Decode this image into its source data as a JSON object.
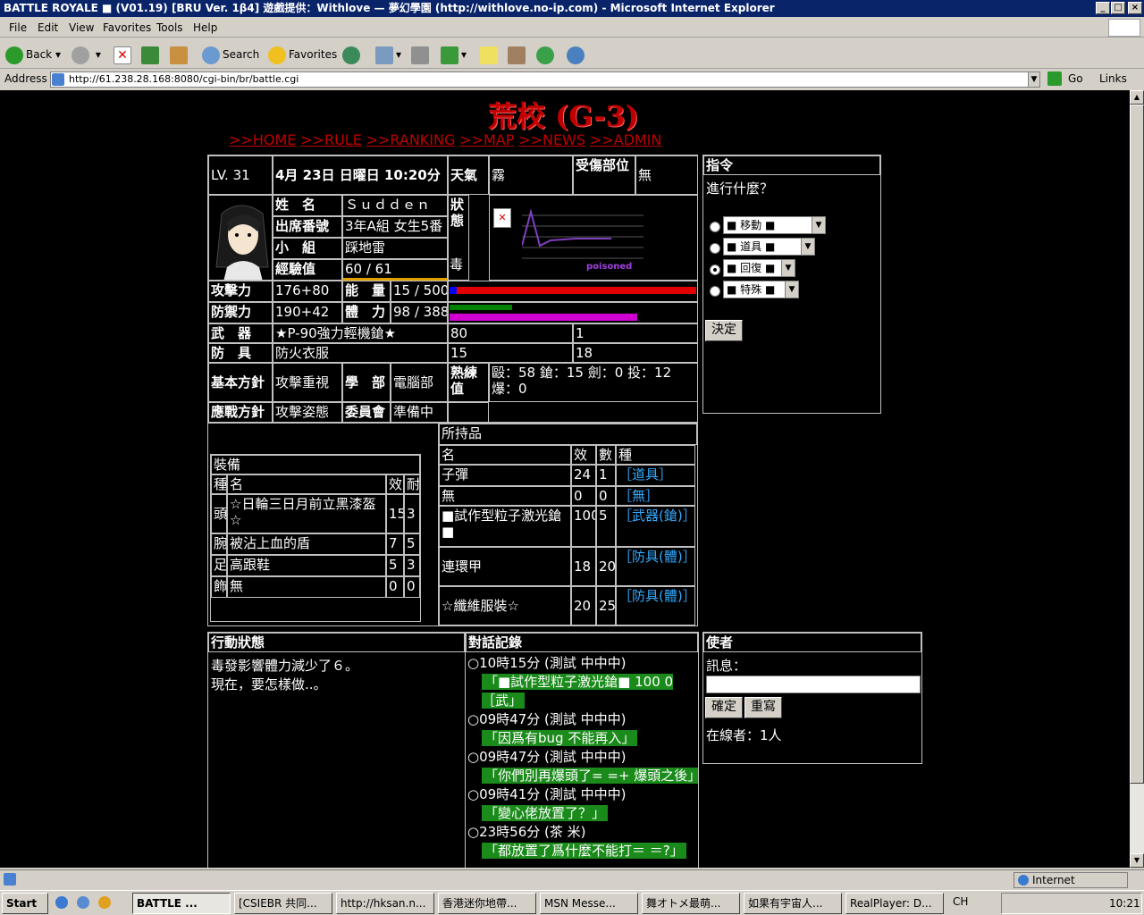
{
  "window": {
    "title": "BATTLE ROYALE ■ (V01.19) [BRU Ver. 1β4] 遊戲提供：Withlove — 夢幻學園 (http://withlove.no-ip.com) - Microsoft Internet Explorer"
  },
  "menu": {
    "file": "File",
    "edit": "Edit",
    "view": "View",
    "favorites": "Favorites",
    "tools": "Tools",
    "help": "Help"
  },
  "toolbar": {
    "back": "Back",
    "search": "Search",
    "favorites": "Favorites"
  },
  "address": {
    "label": "Address",
    "url": "http://61.238.28.168:8080/cgi-bin/br/battle.cgi",
    "go": "Go",
    "links": "Links"
  },
  "page": {
    "title": "荒校 (G-3)",
    "nav": [
      ">>HOME",
      ">>RULE",
      ">>RANKING",
      ">>MAP",
      ">>NEWS",
      ">>ADMIN"
    ],
    "level": "LV. 31",
    "date": "4月 23日 日曜日 10:20分",
    "weather_label": "天氣",
    "weather": "霧",
    "injury_label": "受傷部位",
    "injury": "無",
    "name_label": "姓　名",
    "name": "Ｓｕｄｄｅｎ",
    "seat_label": "出席番號",
    "seat": "3年A組 女生5番",
    "group_label": "小　組",
    "group": "踩地雷",
    "exp_label": "經驗值",
    "exp": "60 / 61",
    "status_label": "狀態",
    "status": "毒",
    "status_img": "poisoned",
    "atk_label": "攻擊力",
    "atk": "176+80",
    "energy_label": "能　量",
    "energy": "15 / 500",
    "def_label": "防禦力",
    "def": "190+42",
    "hp_label": "體　力",
    "hp": "98 / 388",
    "weapon_label": "武　器",
    "weapon": "★P-90強力輕機鎗★",
    "weapon_e": "80",
    "weapon_n": "1",
    "armor_label": "防　具",
    "armor": "防火衣服",
    "armor_e": "15",
    "armor_n": "18",
    "policy_label": "基本方針",
    "policy": "攻擊重視",
    "dept_label": "學　部",
    "dept": "電腦部",
    "skill_label": "熟練值",
    "skill": "毆：58 鎗：15 劍：0 投：12 爆：0",
    "combat_label": "應戰方針",
    "combat": "攻擊姿態",
    "committee_label": "委員會",
    "committee": "準備中",
    "command": {
      "title": "指令",
      "prompt": "進行什麼？",
      "options": [
        "■ 移動 ■",
        "■ 道具 ■",
        "■ 回復 ■",
        "■ 特殊 ■"
      ],
      "submit": "決定"
    },
    "equip": {
      "title": "裝備",
      "h_type": "種",
      "h_name": "名",
      "h_eff": "效",
      "h_dur": "耐",
      "rows": [
        [
          "頭",
          "☆日輪三日月前立黑漆盔☆",
          "15",
          "3"
        ],
        [
          "腕",
          "被沾上血的盾",
          "7",
          "5"
        ],
        [
          "足",
          "高跟鞋",
          "5",
          "3"
        ],
        [
          "飾",
          "無",
          "0",
          "0"
        ]
      ]
    },
    "items": {
      "title": "所持品",
      "h_name": "名",
      "h_eff": "效",
      "h_cnt": "數",
      "h_type": "種",
      "rows": [
        [
          "子彈",
          "24",
          "1",
          "［道具］"
        ],
        [
          "無",
          "0",
          "0",
          "［無］"
        ],
        [
          "■試作型粒子激光鎗■",
          "100",
          "5",
          "［武器(鎗)］"
        ],
        [
          "連環甲",
          "18",
          "20",
          "［防具(體)］"
        ],
        [
          "☆纖維服裝☆",
          "20",
          "25",
          "［防具(體)］"
        ]
      ]
    },
    "action": {
      "title": "行動狀態",
      "line1": "毒發影響體力減少了６。",
      "line2": "現在，要怎樣做..。"
    },
    "log": {
      "title": "對話記錄",
      "entries": [
        [
          "○10時15分 (測試 中中中)",
          "「■試作型粒子激光鎗■ 100 0 ［武」"
        ],
        [
          "○09時47分 (測試 中中中)",
          "「因爲有bug 不能再入」"
        ],
        [
          "○09時47分 (測試 中中中)",
          "「你們別再爆頭了= =+ 爆頭之後」"
        ],
        [
          "○09時41分 (測試 中中中)",
          "「變心佬放置了？」"
        ],
        [
          "○23時56分 (茶 米)",
          "「都放置了爲什麼不能打＝ ＝?」"
        ]
      ]
    },
    "messenger": {
      "title": "使者",
      "msg_label": "訊息：",
      "ok": "確定",
      "reset": "重寫",
      "online": "在線者：1人"
    }
  },
  "statusbar": {
    "zone": "Internet"
  },
  "taskbar": {
    "start": "Start",
    "tasks": [
      "BATTLE ...",
      "[CSIEBR 共同...",
      "http://hksan.n...",
      "香港迷你地帶...",
      "MSN Messe...",
      "舞オトメ最萌...",
      "如果有宇宙人...",
      "RealPlayer: D..."
    ],
    "lang": "CH",
    "clock": "10:21"
  },
  "colors": {
    "energy_bar": "#e00000",
    "hp_bar": "#d000d0",
    "hp_green": "#008000"
  },
  "meters": {
    "energy_fraction": 0.03,
    "hp_fraction": 0.25
  }
}
